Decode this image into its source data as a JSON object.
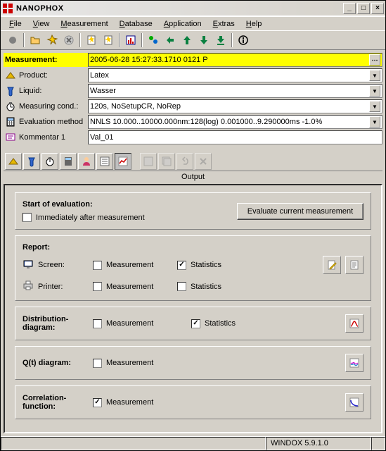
{
  "window": {
    "title": "NANOPHOX"
  },
  "menu": {
    "file": "File",
    "view": "View",
    "measurement": "Measurement",
    "database": "Database",
    "application": "Application",
    "extras": "Extras",
    "help": "Help"
  },
  "fields": {
    "measurement": {
      "label": "Measurement:",
      "value": "2005-06-28 15:27:33.1710 0121 P"
    },
    "product": {
      "label": "Product:",
      "value": "Latex"
    },
    "liquid": {
      "label": "Liquid:",
      "value": "Wasser"
    },
    "meascond": {
      "label": "Measuring cond.:",
      "value": "120s, NoSetupCR, NoRep"
    },
    "evalmethod": {
      "label": "Evaluation method",
      "value": "NNLS 10.000..10000.000nm:128(log) 0.001000..9.290000ms -1.0%"
    },
    "kommentar": {
      "label": "Kommentar 1",
      "value": "Val_01"
    }
  },
  "output": {
    "tablabel": "Output",
    "startEval": {
      "title": "Start of evaluation:",
      "immediately": "Immediately after measurement",
      "evaluateBtn": "Evaluate current measurement"
    },
    "report": {
      "title": "Report:",
      "screen": "Screen:",
      "printer": "Printer:",
      "measurement": "Measurement",
      "statistics": "Statistics"
    },
    "distDiagram": {
      "title": "Distribution-\ndiagram:",
      "measurement": "Measurement",
      "statistics": "Statistics"
    },
    "qtDiagram": {
      "title": "Q(t) diagram:",
      "measurement": "Measurement"
    },
    "correlation": {
      "title": "Correlation-\nfunction:",
      "measurement": "Measurement"
    }
  },
  "statusbar": {
    "version": "WINDOX 5.9.1.0"
  }
}
